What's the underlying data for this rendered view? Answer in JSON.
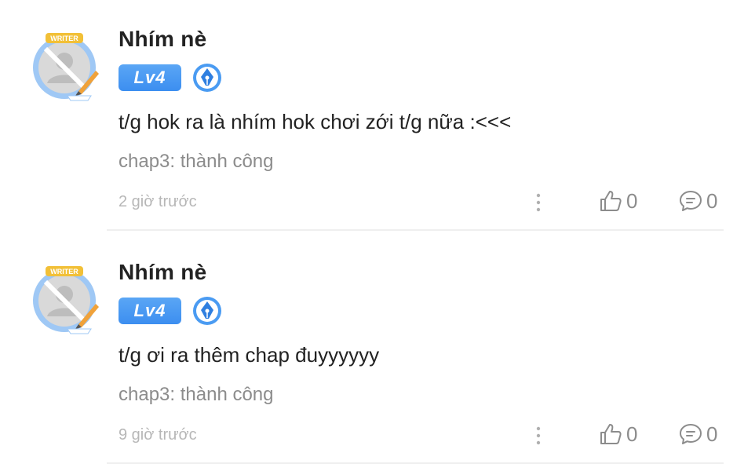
{
  "comments": [
    {
      "username": "Nhím nè",
      "level": "Lv4",
      "avatar_frame_label": "WRITER",
      "content": "t/g hok ra là nhím hok chơi zới t/g nữa :<<<",
      "chapter": "chap3: thành công",
      "time": "2 giờ trước",
      "likes": "0",
      "replies": "0"
    },
    {
      "username": "Nhím nè",
      "level": "Lv4",
      "avatar_frame_label": "WRITER",
      "content": "t/g ơi ra thêm chap đuyyyyyy",
      "chapter": "chap3: thành công",
      "time": "9 giờ trước",
      "likes": "0",
      "replies": "0"
    }
  ],
  "colors": {
    "level_badge": "#4a9bf2",
    "muted_text": "#8c8c8c",
    "time_text": "#b7b7b7"
  },
  "icons": {
    "more": "vertical-dots-icon",
    "like": "thumbs-up-icon",
    "reply": "speech-bubble-icon",
    "writer": "fountain-pen-icon"
  }
}
